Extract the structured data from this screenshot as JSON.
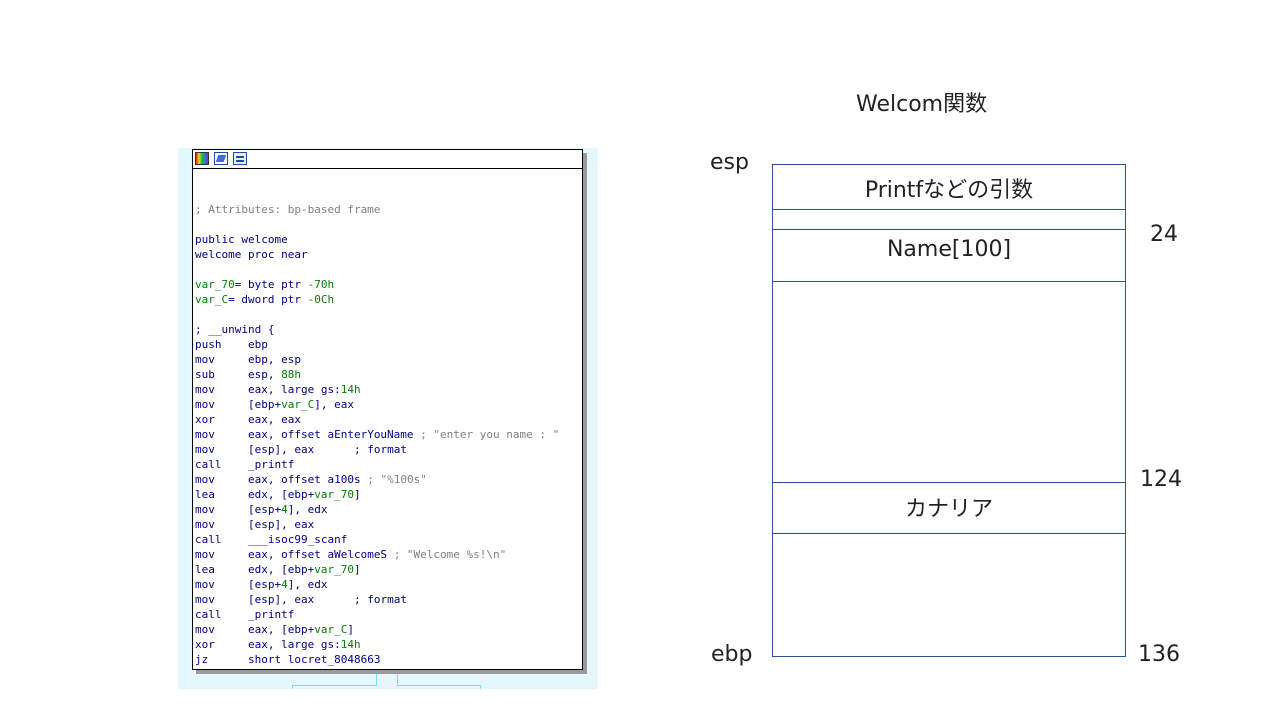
{
  "diagram": {
    "title": "Welcom関数",
    "labels": {
      "esp": "esp",
      "ebp": "ebp",
      "offset_24": "24",
      "offset_124": "124",
      "offset_136": "136"
    },
    "cells": {
      "printf_args": "Printfなどの引数",
      "name_buffer": "Name[100]",
      "canary": "カナリア"
    },
    "border_color": "#2f528f"
  },
  "ida": {
    "toolbar_icons": [
      "color-palette-icon",
      "edit-icon",
      "graph-icon"
    ],
    "colors": {
      "mnemonic": "#000080",
      "comment": "#808080",
      "number": "#008000"
    },
    "lines": [
      [
        "; Attributes: bp-based frame"
      ],
      [
        ""
      ],
      [
        "public welcome"
      ],
      [
        "welcome proc near"
      ],
      [
        ""
      ],
      [
        "var_70= byte ptr -70h"
      ],
      [
        "var_C= dword ptr -0Ch"
      ],
      [
        ""
      ],
      [
        "; __unwind {"
      ],
      [
        "push",
        "ebp"
      ],
      [
        "mov",
        "ebp, esp"
      ],
      [
        "sub",
        "esp, 88h"
      ],
      [
        "mov",
        "eax, large gs:14h"
      ],
      [
        "mov",
        "[ebp+var_C], eax"
      ],
      [
        "xor",
        "eax, eax"
      ],
      [
        "mov",
        "eax, offset aEnterYouName",
        "; \"enter you name : \""
      ],
      [
        "mov",
        "[esp], eax",
        "; format"
      ],
      [
        "call",
        "_printf"
      ],
      [
        "mov",
        "eax, offset a100s",
        "; \"%100s\""
      ],
      [
        "lea",
        "edx, [ebp+var_70]"
      ],
      [
        "mov",
        "[esp+4], edx"
      ],
      [
        "mov",
        "[esp], eax"
      ],
      [
        "call",
        "___isoc99_scanf"
      ],
      [
        "mov",
        "eax, offset aWelcomeS",
        "; \"Welcome %s!\\n\""
      ],
      [
        "lea",
        "edx, [ebp+var_70]"
      ],
      [
        "mov",
        "[esp+4], edx"
      ],
      [
        "mov",
        "[esp], eax",
        "; format"
      ],
      [
        "call",
        "_printf"
      ],
      [
        "mov",
        "eax, [ebp+var_C]"
      ],
      [
        "xor",
        "eax, large gs:14h"
      ],
      [
        "jz",
        "short locret_8048663"
      ]
    ]
  }
}
